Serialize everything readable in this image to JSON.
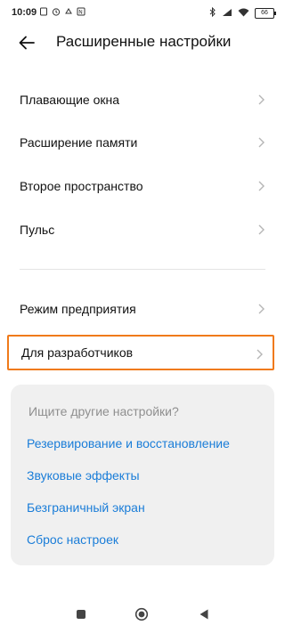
{
  "status_bar": {
    "time": "10:09",
    "battery": "66",
    "icons": [
      "sim-card-icon",
      "alarm-icon",
      "notification-icon",
      "nfc-icon",
      "bluetooth-icon",
      "signal-icon",
      "wifi-icon",
      "battery-icon"
    ]
  },
  "header": {
    "title": "Расширенные настройки",
    "back_icon": "arrow-left-icon"
  },
  "list": {
    "items": [
      {
        "label": "Плавающие окна"
      },
      {
        "label": "Расширение памяти"
      },
      {
        "label": "Второе пространство"
      },
      {
        "label": "Пульс"
      },
      {
        "label": "Режим предприятия"
      },
      {
        "label": "Для разработчиков"
      }
    ],
    "highlight_color": "#f07a1a"
  },
  "suggestions": {
    "hint": "Ищите другие настройки?",
    "links": [
      {
        "label": "Резервирование и восстановление"
      },
      {
        "label": "Звуковые эффекты"
      },
      {
        "label": "Безграничный экран"
      },
      {
        "label": "Сброс настроек"
      }
    ],
    "link_color": "#1a7dd8"
  },
  "nav_bar": {
    "icons": [
      "recent-apps-icon",
      "home-icon",
      "back-icon"
    ]
  }
}
